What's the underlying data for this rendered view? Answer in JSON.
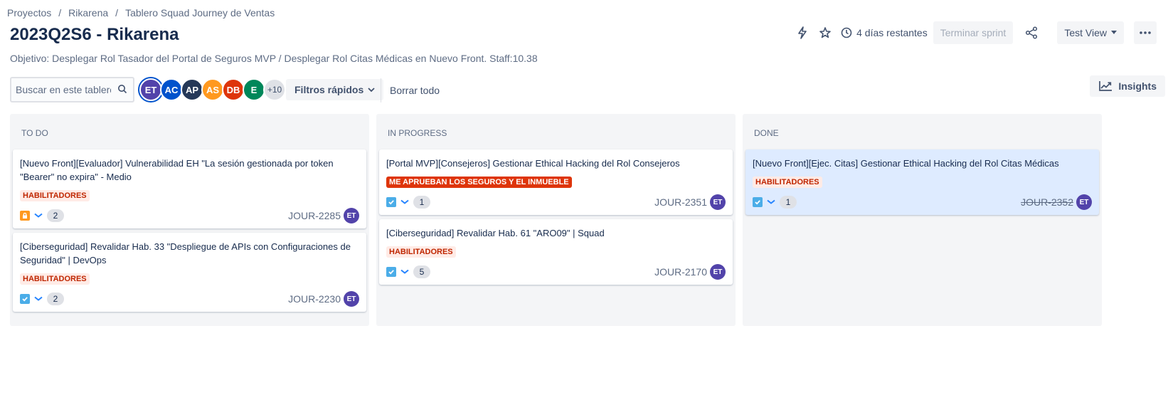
{
  "breadcrumb": [
    "Proyectos",
    "Rikarena",
    "Tablero Squad Journey de Ventas"
  ],
  "breadcrumb_sep": "/",
  "title": "2023Q2S6 - Rikarena",
  "goal": "Objetivo: Desplegar Rol Tasador del Portal de Seguros MVP / Desplegar Rol Citas Médicas en Nuevo Front. Staff:10.38",
  "header": {
    "days_remaining": "4 días restantes",
    "complete_sprint": "Terminar sprint",
    "view_select": "Test View"
  },
  "toolbar": {
    "search_placeholder": "Buscar en este tablero",
    "avatars": [
      {
        "initials": "ET",
        "color": "#5243aa"
      },
      {
        "initials": "AC",
        "color": "#0052cc"
      },
      {
        "initials": "AP",
        "color": "#253858"
      },
      {
        "initials": "AS",
        "color": "#ff991f"
      },
      {
        "initials": "DB",
        "color": "#de350b"
      },
      {
        "initials": "E",
        "color": "#00875a"
      }
    ],
    "avatars_more": "+10",
    "quick_filters": "Filtros rápidos",
    "clear_all": "Borrar todo",
    "insights": "Insights"
  },
  "columns": [
    {
      "name": "TO DO",
      "cards": [
        {
          "title": "[Nuevo Front][Evaluador] Vulnerabilidad EH \"La sesión gestionada por token \"Bearer\" no expira\" - Medio",
          "label": "HABILITADORES",
          "label_style": "hab",
          "type": "lock",
          "points": "2",
          "key": "JOUR-2285",
          "assignee": "ET",
          "done": false
        },
        {
          "title": "[Ciberseguridad] Revalidar Hab. 33 \"Despliegue de APIs con Configuraciones de Seguridad\" | DevOps",
          "label": "HABILITADORES",
          "label_style": "hab",
          "type": "check",
          "points": "2",
          "key": "JOUR-2230",
          "assignee": "ET",
          "done": false
        }
      ]
    },
    {
      "name": "IN PROGRESS",
      "cards": [
        {
          "title": "[Portal MVP][Consejeros] Gestionar Ethical Hacking del Rol Consejeros",
          "label": "ME APRUEBAN LOS SEGUROS Y EL INMUEBLE",
          "label_style": "red",
          "type": "check",
          "points": "1",
          "key": "JOUR-2351",
          "assignee": "ET",
          "done": false
        },
        {
          "title": "[Ciberseguridad] Revalidar Hab. 61 \"ARO09\" | Squad",
          "label": "HABILITADORES",
          "label_style": "hab",
          "type": "check",
          "points": "5",
          "key": "JOUR-2170",
          "assignee": "ET",
          "done": false
        }
      ]
    },
    {
      "name": "DONE",
      "cards": [
        {
          "title": "[Nuevo Front][Ejec. Citas] Gestionar Ethical Hacking del Rol Citas Médicas",
          "label": "HABILITADORES",
          "label_style": "hab",
          "type": "check",
          "points": "1",
          "key": "JOUR-2352",
          "assignee": "ET",
          "done": true
        }
      ]
    }
  ]
}
